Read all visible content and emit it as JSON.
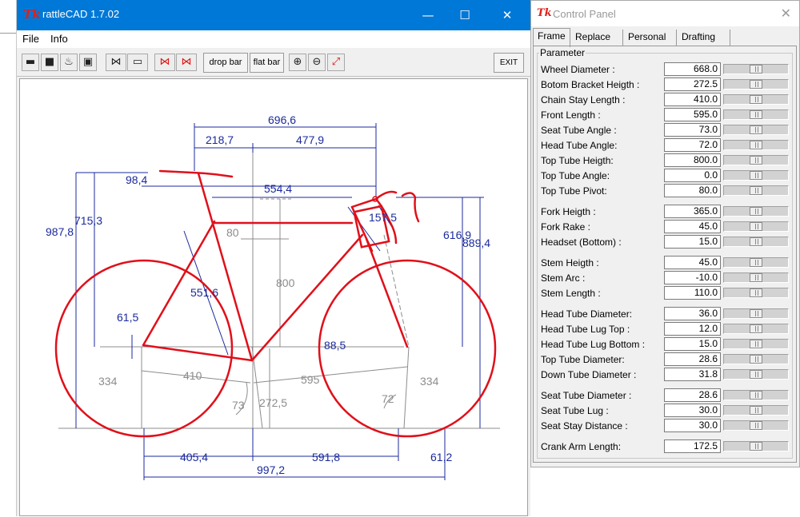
{
  "main_window": {
    "title": "rattleCAD  1.7.02",
    "logo": "Tk",
    "controls": {
      "minimize": "—",
      "maximize": "☐",
      "close": "✕"
    },
    "menu": [
      "File",
      "Info"
    ],
    "toolbar": {
      "drop_bar_label": "drop bar",
      "flat_bar_label": "flat bar",
      "exit_label": "EXIT"
    }
  },
  "drawing": {
    "dimensions": {
      "top_total": "696,6",
      "top_left": "218,7",
      "top_right": "477,9",
      "reach_small": "98,4",
      "top_tube": "554,4",
      "stack_left_outer": "987,8",
      "stack_left_inner": "715,3",
      "fork_offset": "80",
      "head_tube": "157,5",
      "right_616": "616,9",
      "right_889": "889,4",
      "seat_tube_len": "551,6",
      "seat_center": "800",
      "crank": "61,5",
      "bb_drop": "88,5",
      "chain_stay_proj": "410",
      "front_proj": "595",
      "left_wheel_334": "334",
      "right_wheel_334": "334",
      "seat_angle": "73",
      "bb_height": "272,5",
      "head_angle": "72",
      "bottom_left": "405,4",
      "bottom_right": "591,8",
      "bottom_small": "61,2",
      "wheelbase": "997,2"
    },
    "colors": {
      "frame": "#e0101a",
      "dimension": "#1b2a9c",
      "construction": "#8c8c8c"
    }
  },
  "control_panel": {
    "title": "Control Panel",
    "logo": "Tk",
    "close": "✕",
    "tabs": [
      "Frame",
      "Replace",
      "Personal",
      "Drafting"
    ],
    "active_tab": "Frame",
    "group_label": "Parameter",
    "params": [
      {
        "label": "Wheel Diameter :",
        "value": "668.0"
      },
      {
        "label": "Botom Bracket Heigth :",
        "value": "272.5"
      },
      {
        "label": "Chain Stay Length :",
        "value": "410.0"
      },
      {
        "label": "Front Length :",
        "value": "595.0"
      },
      {
        "label": "Seat Tube Angle :",
        "value": "73.0"
      },
      {
        "label": "Head Tube Angle:",
        "value": "72.0"
      },
      {
        "label": "Top Tube Heigth:",
        "value": "800.0"
      },
      {
        "label": "Top Tube Angle:",
        "value": "0.0"
      },
      {
        "label": "Top Tube Pivot:",
        "value": "80.0"
      },
      {
        "label": "Fork Heigth :",
        "value": "365.0"
      },
      {
        "label": "Fork Rake :",
        "value": "45.0"
      },
      {
        "label": "Headset (Bottom) :",
        "value": "15.0"
      },
      {
        "label": "Stem Heigth :",
        "value": "45.0"
      },
      {
        "label": "Stem Arc :",
        "value": "-10.0"
      },
      {
        "label": "Stem Length :",
        "value": "110.0"
      },
      {
        "label": "Head Tube Diameter:",
        "value": "36.0"
      },
      {
        "label": "Head Tube Lug Top :",
        "value": "12.0"
      },
      {
        "label": "Head Tube Lug Bottom :",
        "value": "15.0"
      },
      {
        "label": "Top  Tube Diameter:",
        "value": "28.6"
      },
      {
        "label": "Down Tube Diameter :",
        "value": "31.8"
      },
      {
        "label": "Seat Tube Diameter :",
        "value": "28.6"
      },
      {
        "label": "Seat Tube Lug :",
        "value": "30.0"
      },
      {
        "label": "Seat Stay Distance :",
        "value": "30.0"
      },
      {
        "label": "Crank Arm Length:",
        "value": "172.5"
      }
    ]
  }
}
